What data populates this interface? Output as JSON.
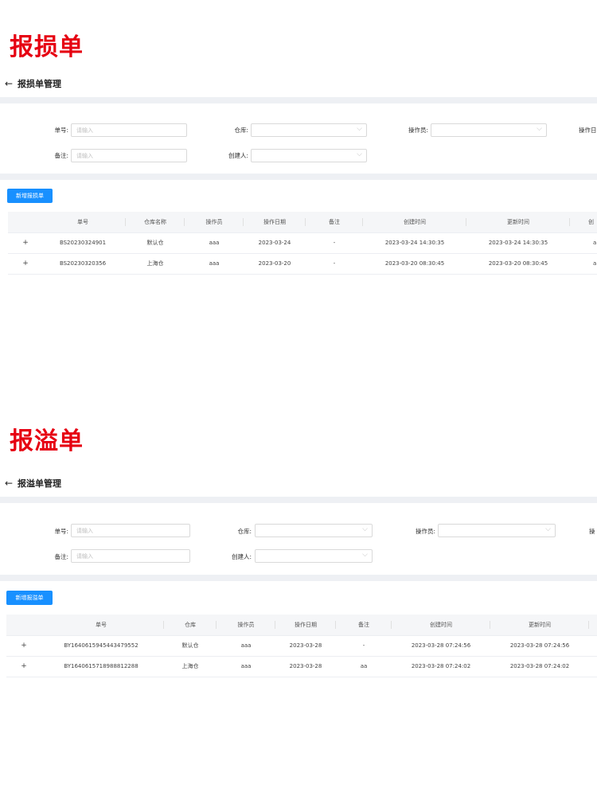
{
  "s1": {
    "big_title": "报损单",
    "page_title": "报损单管理",
    "filters": {
      "danhao_label": "单号:",
      "danhao_placeholder": "请输入",
      "cangku_label": "仓库:",
      "caozuoyuan_label": "操作员:",
      "caozuori_label": "操作日",
      "beizhu_label": "备注:",
      "beizhu_placeholder": "请输入",
      "chuangjianren_label": "创建人:"
    },
    "new_button": "新增报损单",
    "headers": [
      "单号",
      "仓库名称",
      "操作员",
      "操作日期",
      "备注",
      "创建时间",
      "更新时间",
      "创"
    ],
    "rows": [
      {
        "expand": "+",
        "cells": [
          "BS20230324901",
          "默认仓",
          "aaa",
          "2023-03-24",
          "-",
          "2023-03-24 14:30:35",
          "2023-03-24 14:30:35",
          "a"
        ]
      },
      {
        "expand": "+",
        "cells": [
          "BS20230320356",
          "上海仓",
          "aaa",
          "2023-03-20",
          "-",
          "2023-03-20 08:30:45",
          "2023-03-20 08:30:45",
          "a"
        ]
      }
    ]
  },
  "s2": {
    "big_title": "报溢单",
    "page_title": "报溢单管理",
    "filters": {
      "danhao_label": "单号:",
      "danhao_placeholder": "请输入",
      "cangku_label": "仓库:",
      "caozuoyuan_label": "操作员:",
      "caozuori_label": "操",
      "beizhu_label": "备注:",
      "beizhu_placeholder": "请输入",
      "chuangjianren_label": "创建人:"
    },
    "new_button": "新增报溢单",
    "headers": [
      "单号",
      "仓库",
      "操作员",
      "操作日期",
      "备注",
      "创建时间",
      "更新时间"
    ],
    "rows": [
      {
        "expand": "+",
        "cells": [
          "BY1640615945443479552",
          "默认仓",
          "aaa",
          "2023-03-28",
          "-",
          "2023-03-28 07:24:56",
          "2023-03-28 07:24:56"
        ]
      },
      {
        "expand": "+",
        "cells": [
          "BY1640615718988812288",
          "上海仓",
          "aaa",
          "2023-03-28",
          "aa",
          "2023-03-28 07:24:02",
          "2023-03-28 07:24:02"
        ]
      }
    ]
  },
  "icons": {
    "back": "arrow-left-icon",
    "dropdown": "chevron-down-icon",
    "expand": "plus-icon"
  },
  "colors": {
    "title_red": "#e60012",
    "primary_blue": "#1890ff",
    "band_gray": "#eef0f4"
  }
}
